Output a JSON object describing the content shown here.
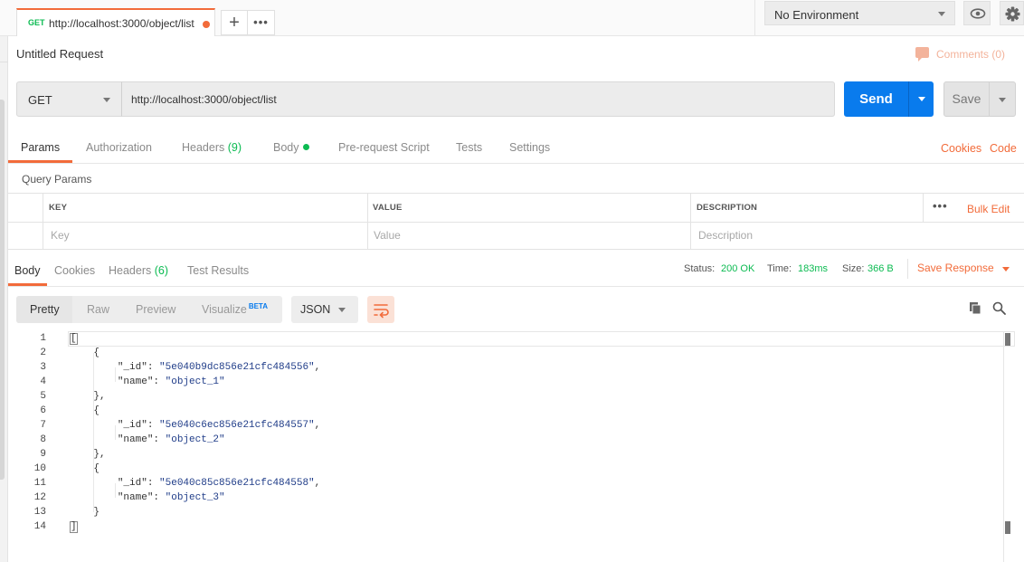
{
  "tab": {
    "method": "GET",
    "url": "http://localhost:3000/object/list"
  },
  "tabbar": {
    "new_tab": "+",
    "more": "•••"
  },
  "environment": {
    "label": "No Environment"
  },
  "request": {
    "title": "Untitled Request",
    "comments": "Comments (0)",
    "method": "GET",
    "url": "http://localhost:3000/object/list",
    "send": "Send",
    "save": "Save"
  },
  "request_tabs": [
    {
      "label": "Params"
    },
    {
      "label": "Authorization"
    },
    {
      "label": "Headers",
      "count": "(9)"
    },
    {
      "label": "Body"
    },
    {
      "label": "Pre-request Script"
    },
    {
      "label": "Tests"
    },
    {
      "label": "Settings"
    }
  ],
  "right_links": {
    "cookies": "Cookies",
    "code": "Code"
  },
  "query_params": {
    "title": "Query Params",
    "columns": [
      "KEY",
      "VALUE",
      "DESCRIPTION"
    ],
    "placeholders": [
      "Key",
      "Value",
      "Description"
    ],
    "more": "•••",
    "bulk_edit": "Bulk Edit"
  },
  "response_tabs": [
    {
      "label": "Body"
    },
    {
      "label": "Cookies"
    },
    {
      "label": "Headers",
      "count": "(6)"
    },
    {
      "label": "Test Results"
    }
  ],
  "response_meta": {
    "status_label": "Status:",
    "status": "200 OK",
    "time_label": "Time:",
    "time": "183ms",
    "size_label": "Size:",
    "size": "366 B",
    "save_response": "Save Response"
  },
  "body_toolbar": {
    "formats": [
      "Pretty",
      "Raw",
      "Preview",
      "Visualize"
    ],
    "beta": "BETA",
    "language": "JSON"
  },
  "code_lines": [
    "[",
    "    {",
    "        \"_id\": \"5e040b9dc856e21cfc484556\",",
    "        \"name\": \"object_1\"",
    "    },",
    "    {",
    "        \"_id\": \"5e040c6ec856e21cfc484557\",",
    "        \"name\": \"object_2\"",
    "    },",
    "    {",
    "        \"_id\": \"5e040c85c856e21cfc484558\",",
    "        \"name\": \"object_3\"",
    "    }",
    "]"
  ],
  "colors": {
    "accent": "#f26b3a",
    "send": "#097bed",
    "success": "#0cbb52"
  }
}
